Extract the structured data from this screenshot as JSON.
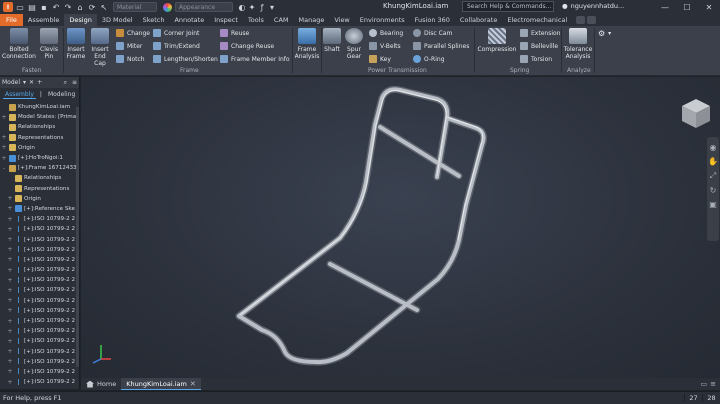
{
  "titlebar": {
    "material_placeholder": "Material",
    "appearance_placeholder": "Appearance",
    "document_title": "KhungKimLoai.iam",
    "search_placeholder": "Search Help & Commands...",
    "user_name": "nguyennhatdu..."
  },
  "tabs": [
    "File",
    "Assemble",
    "Design",
    "3D Model",
    "Sketch",
    "Annotate",
    "Inspect",
    "Tools",
    "CAM",
    "Manage",
    "View",
    "Environments",
    "Fusion 360",
    "Collaborate",
    "Electromechanical"
  ],
  "active_tab": "Design",
  "ribbon": {
    "fasten": {
      "label": "Fasten",
      "bolted": "Bolted Connection",
      "clevis": "Clevis Pin"
    },
    "frame": {
      "label": "Frame",
      "insert_frame": "Insert Frame",
      "insert_end_cap": "Insert End Cap",
      "change": "Change",
      "miter": "Miter",
      "notch": "Notch",
      "corner_joint": "Corner Joint",
      "trim_extend": "Trim/Extend",
      "lengthen_shorten": "Lengthen/Shorten",
      "reuse": "Reuse",
      "change_reuse": "Change Reuse",
      "frame_member_info": "Frame Member Info"
    },
    "frame_analysis": "Frame Analysis",
    "power": {
      "label": "Power Transmission",
      "shaft": "Shaft",
      "spur_gear": "Spur Gear",
      "bearing": "Bearing",
      "v_belts": "V-Belts",
      "key": "Key",
      "disc_cam": "Disc Cam",
      "parallel_splines": "Parallel Splines",
      "o_ring": "O-Ring"
    },
    "spring": {
      "label": "Spring",
      "compression": "Compression",
      "extension": "Extension",
      "belleville": "Belleville",
      "torsion": "Torsion"
    },
    "analyze": {
      "label": "Analyze",
      "tolerance": "Tolerance Analysis"
    }
  },
  "panel": {
    "title": "Model",
    "tab_assembly": "Assembly",
    "tab_modeling": "Modeling",
    "tree": [
      {
        "label": "KhungKimLoai.iam",
        "icon": "asm",
        "exp": "",
        "indent": 0
      },
      {
        "label": "Model States: [Primar",
        "icon": "folder",
        "exp": "+",
        "indent": 0
      },
      {
        "label": "Relationships",
        "icon": "folder",
        "exp": "",
        "indent": 0
      },
      {
        "label": "Representations",
        "icon": "folder",
        "exp": "+",
        "indent": 0
      },
      {
        "label": "Origin",
        "icon": "folder",
        "exp": "+",
        "indent": 0
      },
      {
        "label": "[+]:HoTroNgoi:1",
        "icon": "part",
        "exp": "+",
        "indent": 0
      },
      {
        "label": "[+]:Frame 16712433",
        "icon": "asm",
        "exp": "-",
        "indent": 0
      },
      {
        "label": "Relationships",
        "icon": "folder",
        "exp": "",
        "indent": 1
      },
      {
        "label": "Representations",
        "icon": "folder",
        "exp": "",
        "indent": 1
      },
      {
        "label": "Origin",
        "icon": "folder",
        "exp": "+",
        "indent": 1
      },
      {
        "label": "[+]:Reference Ske",
        "icon": "part",
        "exp": "+",
        "indent": 1
      },
      {
        "label": "[+]:ISO 10799-2 2",
        "icon": "beam",
        "exp": "+",
        "indent": 1
      },
      {
        "label": "[+]:ISO 10799-2 2",
        "icon": "beam",
        "exp": "+",
        "indent": 1
      },
      {
        "label": "[+]:ISO 10799-2 2",
        "icon": "beam",
        "exp": "+",
        "indent": 1
      },
      {
        "label": "[+]:ISO 10799-2 2",
        "icon": "beam",
        "exp": "+",
        "indent": 1
      },
      {
        "label": "[+]:ISO 10799-2 2",
        "icon": "beam",
        "exp": "+",
        "indent": 1
      },
      {
        "label": "[+]:ISO 10799-2 2",
        "icon": "beam",
        "exp": "+",
        "indent": 1
      },
      {
        "label": "[+]:ISO 10799-2 2",
        "icon": "beam",
        "exp": "+",
        "indent": 1
      },
      {
        "label": "[+]:ISO 10799-2 2",
        "icon": "beam",
        "exp": "+",
        "indent": 1
      },
      {
        "label": "[+]:ISO 10799-2 2",
        "icon": "beam",
        "exp": "+",
        "indent": 1
      },
      {
        "label": "[+]:ISO 10799-2 2",
        "icon": "beam",
        "exp": "+",
        "indent": 1
      },
      {
        "label": "[+]:ISO 10799-2 2",
        "icon": "beam",
        "exp": "+",
        "indent": 1
      },
      {
        "label": "[+]:ISO 10799-2 2",
        "icon": "beam",
        "exp": "+",
        "indent": 1
      },
      {
        "label": "[+]:ISO 10799-2 2",
        "icon": "beam",
        "exp": "+",
        "indent": 1
      },
      {
        "label": "[+]:ISO 10799-2 2",
        "icon": "beam",
        "exp": "+",
        "indent": 1
      },
      {
        "label": "[+]:ISO 10799-2 2",
        "icon": "beam",
        "exp": "+",
        "indent": 1
      },
      {
        "label": "[+]:ISO 10799-2 2",
        "icon": "beam",
        "exp": "+",
        "indent": 1
      },
      {
        "label": "[+]:ISO 10799-2 2",
        "icon": "beam",
        "exp": "+",
        "indent": 1
      },
      {
        "label": "[+]:ISO 10799-2 2",
        "icon": "beam",
        "exp": "+",
        "indent": 1
      },
      {
        "label": "[+]:ISO 10799-2 2",
        "icon": "beam",
        "exp": "+",
        "indent": 1
      }
    ]
  },
  "doctabs": {
    "home": "Home",
    "active": "KhungKimLoai.iam"
  },
  "status": {
    "message": "For Help, press F1",
    "n1": "27",
    "n2": "28"
  },
  "colors": {
    "accent": "#e36c2b",
    "selection": "#56a8ea",
    "frame": "#b9bec6"
  }
}
